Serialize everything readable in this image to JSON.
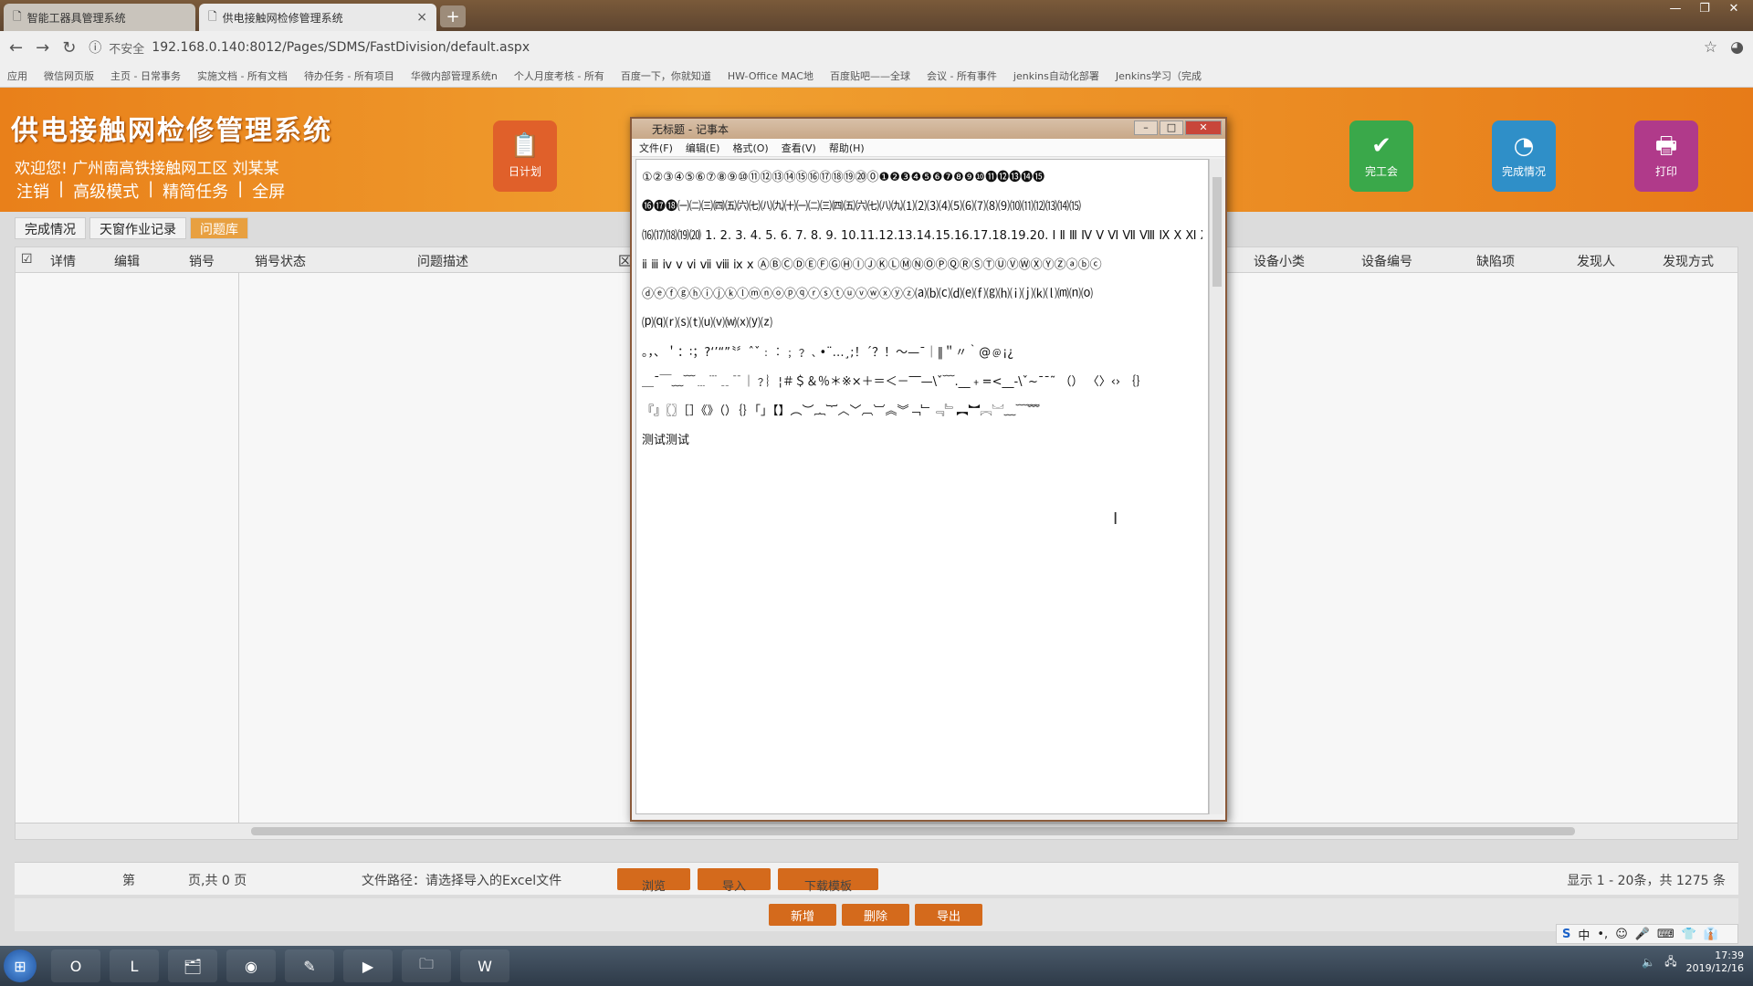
{
  "browser": {
    "tabs": [
      {
        "label": "智能工器具管理系统"
      },
      {
        "label": "供电接触网检修管理系统",
        "close": "×"
      }
    ],
    "new_tab": "+",
    "url_security": "不安全",
    "url": "192.168.0.140:8012/Pages/SDMS/FastDivision/default.aspx",
    "bookmarks": [
      "应用",
      "微信网页版",
      "主页 - 日常事务",
      "实施文档 - 所有文档",
      "待办任务 - 所有项目",
      "华微内部管理系统n",
      "个人月度考核 - 所有",
      "百度一下，你就知道",
      "HW-Office MAC地",
      "百度贴吧——全球",
      "会议 - 所有事件",
      "jenkins自动化部署",
      "Jenkins学习（完成"
    ]
  },
  "app": {
    "title": "供电接触网检修管理系统",
    "welcome": "欢迎您! 广州南高铁接触网工区 刘某某",
    "links": [
      "注销",
      "|",
      "高级模式",
      "|",
      "精简任务",
      "|",
      "全屏"
    ],
    "header_buttons": [
      {
        "label": "日计划",
        "icon": "📋",
        "color": "#e0602a"
      },
      {
        "label": "完工会",
        "icon": "✔",
        "color": "#3aa84a"
      },
      {
        "label": "完成情况",
        "icon": "◔",
        "color": "#2f8fc8"
      },
      {
        "label": "打印",
        "icon": "🖶",
        "color": "#b03a8a"
      }
    ],
    "subtabs": [
      "完成情况",
      "天窗作业记录",
      "问题库"
    ],
    "columns_left": [
      "☑",
      "详情",
      "编辑",
      "销号",
      "销号状态"
    ],
    "column_mid": "问题描述",
    "column_mid2": "区",
    "columns_right": [
      "设备小类",
      "设备编号",
      "缺陷项",
      "发现人",
      "发现方式"
    ],
    "pager": {
      "page_prefix": "第",
      "page_info": "页,共 0 页",
      "file_path": "文件路径：请选择导入的Excel文件",
      "browse": "浏览",
      "import": "导入",
      "download": "下载模板",
      "summary": "显示 1 - 20条，共 1275 条"
    },
    "actions": [
      "新增",
      "删除",
      "导出"
    ]
  },
  "notepad": {
    "title": "无标题 - 记事本",
    "menu": [
      "文件(F)",
      "编辑(E)",
      "格式(O)",
      "查看(V)",
      "帮助(H)"
    ],
    "lines": [
      "①②③④⑤⑥⑦⑧⑨⑩⑪⑫⑬⑭⑮⑯⑰⑱⑲⑳⓪❶❷❸❹❺❻❼❽❾❿⓫⓬⓭⓮⓯",
      "⓰⓱⓲㈠㈡㈢㈣㈤㈥㈦㈧㈨㈩㈠㈡㈢㈣㈤㈥㈦㈧㈨⑴⑵⑶⑷⑸⑹⑺⑻⑼⑽⑾⑿⒀⒁⒂",
      "⒃⒄⒅⒆⒇ 1. 2. 3. 4. 5. 6. 7. 8. 9. 10.11.12.13.14.15.16.17.18.19.20. Ⅰ Ⅱ Ⅲ Ⅳ Ⅴ Ⅵ Ⅶ Ⅷ Ⅸ Ⅹ Ⅺ Ⅻ ⅰ",
      "ⅱ ⅲ ⅳ ⅴ ⅵ ⅶ ⅷ ⅸ ⅹ ⒶⒷⒸⒹⒺⒻⒼⒽⒾⒿⓀⓁⓂⓃⓄⓅⓆⓇⓈⓉⓊⓋⓌⓍⓎⓏⓐⓑⓒ",
      "ⓓⓔⓕⓖⓗⓘⓙⓚⓛⓜⓝⓞⓟⓠⓡⓢⓣⓤⓥⓦⓧⓨⓩ⒜⒝⒞⒟⒠⒡⒢⒣⒤⒥⒦⒧⒨⒩⒪",
      "⒫⒬⒭⒮⒯⒰⒱⒲⒳⒴⒵",
      "。，、＇：∶；?‘’“”〝〞ˆˇ﹕︰﹔﹖﹑•¨…¸;！´？！～—ˉ｜‖＂〃｀@﹫¡¿",
      "＿¯￣﹏﹋﹍﹉﹎﹊｜﹖︴¦＃＄＆％＊※×＋＝＜－‾‾—\\ˇ﹋.__﹢=<__-\\ˇ~ˉˉ˜ （） 〈〉‹› ｛｝",
      "『』〖〗［］《》（）｛｝「」【】︵︶︷︸︿﹀︹︺︽︾﹁﹂﹃﹄︻︼︗︘﹏﹋﹌",
      "测试测试"
    ]
  },
  "ime": [
    "S",
    "中",
    "•,",
    "☺",
    "🎤",
    "⌨",
    "👕",
    "👔"
  ],
  "taskbar": {
    "start": "⊞",
    "apps": [
      "O",
      "L",
      "🗂",
      "◉",
      "✎",
      "▶",
      "🗀",
      "W"
    ],
    "time": "17:39",
    "date": "2019/12/16"
  }
}
